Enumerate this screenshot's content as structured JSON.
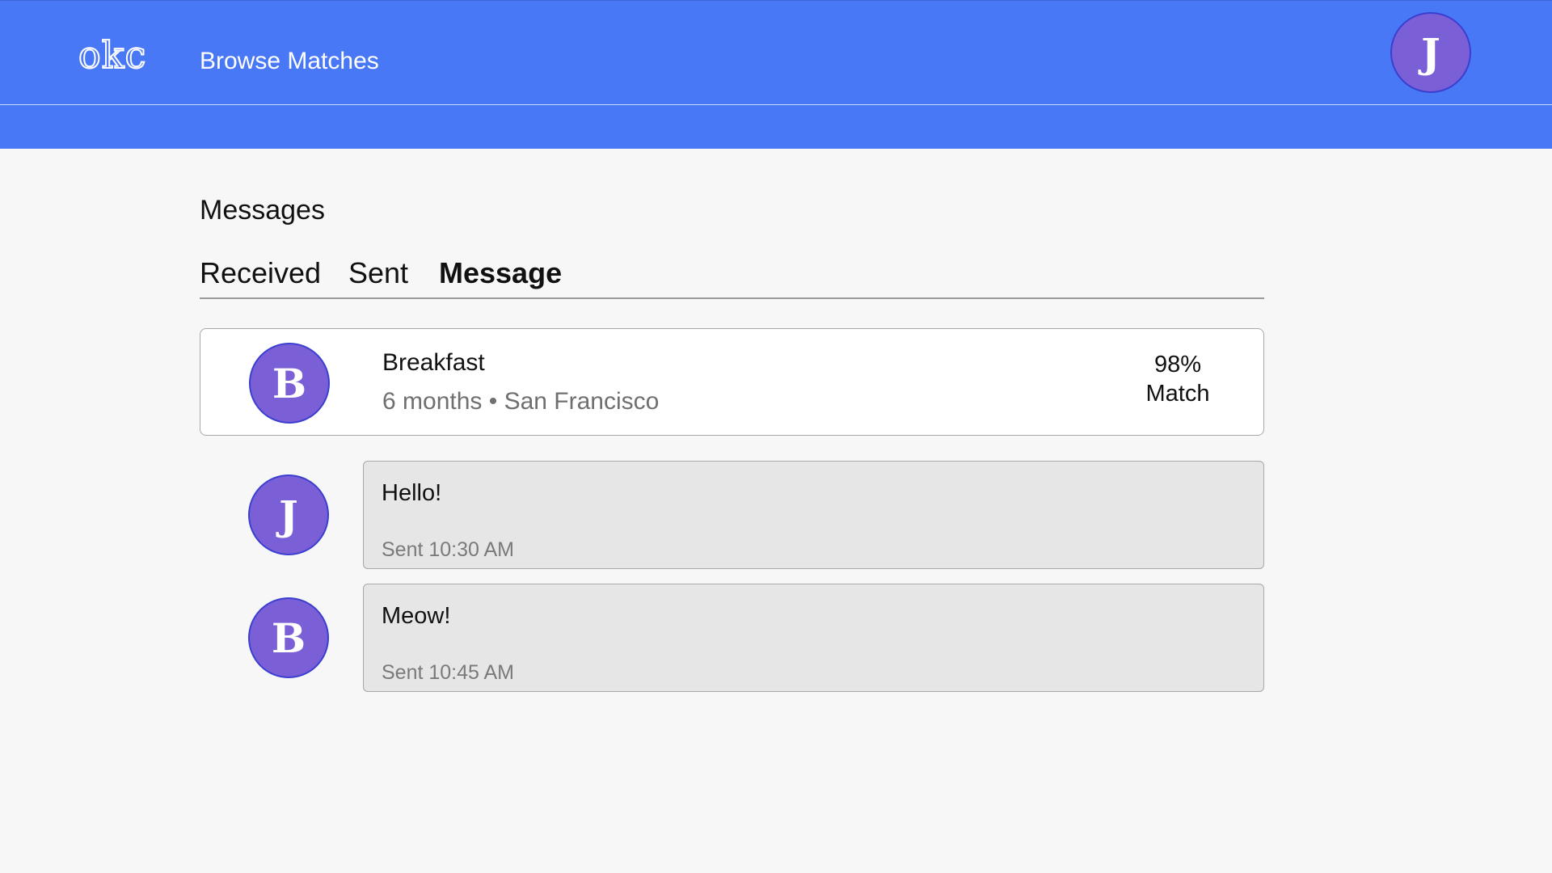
{
  "header": {
    "logo": "okc",
    "nav_link": "Browse Matches",
    "user_initial": "J"
  },
  "page": {
    "title": "Messages",
    "tabs": [
      {
        "label": "Received",
        "active": false
      },
      {
        "label": "Sent",
        "active": false
      },
      {
        "label": "Message",
        "active": true
      }
    ]
  },
  "match": {
    "initial": "B",
    "name": "Breakfast",
    "meta": "6 months • San Francisco",
    "percent": "98%",
    "percent_label": "Match"
  },
  "messages": [
    {
      "initial": "J",
      "text": "Hello!",
      "time": "Sent 10:30 AM"
    },
    {
      "initial": "B",
      "text": "Meow!",
      "time": "Sent 10:45 AM"
    }
  ],
  "colors": {
    "header_bg": "#4878f5",
    "avatar_bg": "#7b5fd6",
    "avatar_border": "#3a3fd0",
    "page_bg": "#f7f7f7",
    "bubble_bg": "#e6e6e6"
  }
}
